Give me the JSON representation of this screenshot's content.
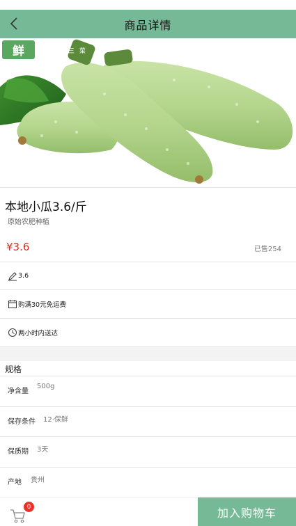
{
  "header": {
    "title": "商品详情",
    "back_icon": "chevron-left-icon"
  },
  "hero": {
    "badge_text": "鲜",
    "badge_sub": "三 菜"
  },
  "product": {
    "name": "本地小瓜3.6/斤",
    "subtitle": "原始农肥种植",
    "price": "¥3.6",
    "sold": "已售254"
  },
  "info": [
    {
      "icon": "pencil-icon",
      "text": "3.6"
    },
    {
      "icon": "calendar-icon",
      "text": "购满30元免运费"
    },
    {
      "icon": "clock-icon",
      "text": "两小时内送达"
    }
  ],
  "specs": {
    "title": "规格",
    "rows": [
      {
        "label": "净含量",
        "value": "500g"
      },
      {
        "label": "保存条件",
        "value": "12·保鲜"
      },
      {
        "label": "保质期",
        "value": "3天"
      },
      {
        "label": "产地",
        "value": "贵州"
      }
    ]
  },
  "bottom": {
    "cart_count": "0",
    "add_to_cart": "加入购物车"
  },
  "colors": {
    "theme": "#76b996",
    "price": "#e0281f",
    "badge": "#e8322a"
  }
}
